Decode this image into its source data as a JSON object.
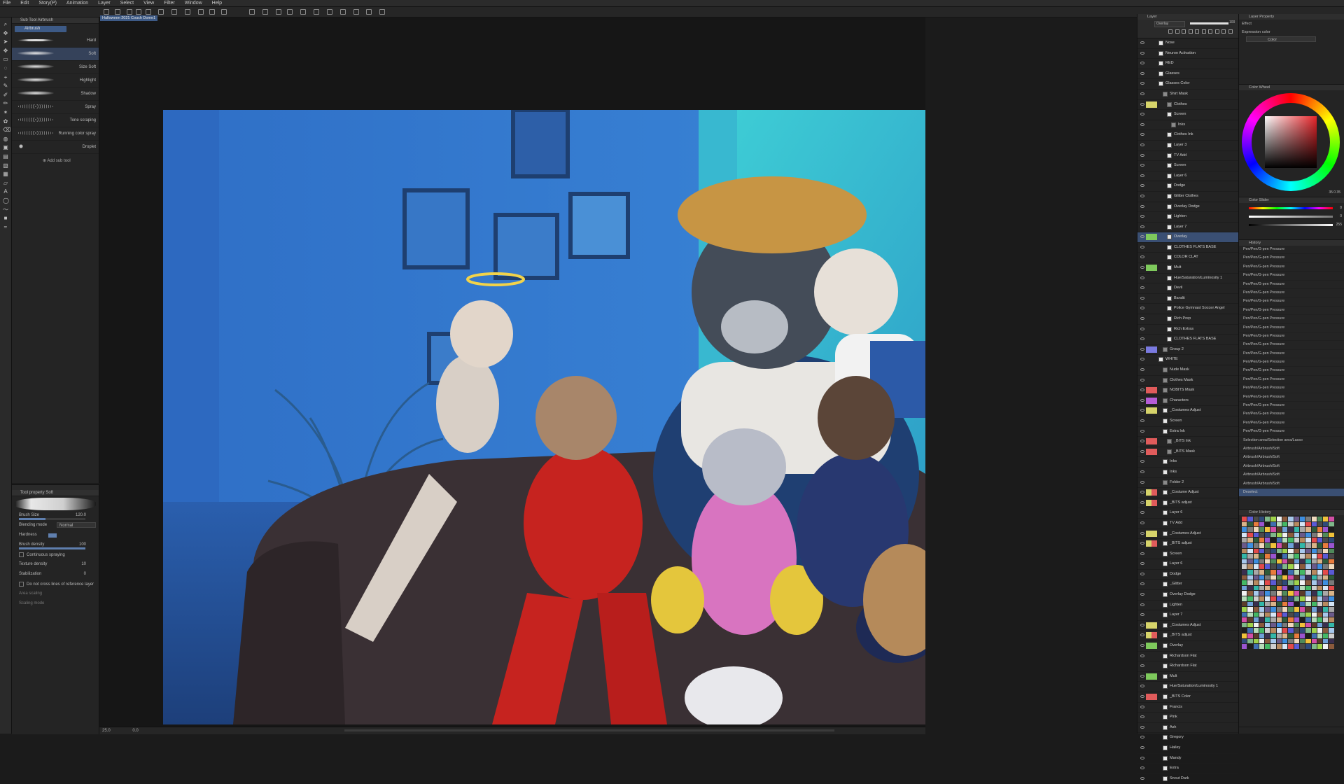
{
  "menu": [
    "File",
    "Edit",
    "Story(P)",
    "Animation",
    "Layer",
    "Select",
    "View",
    "Filter",
    "Window",
    "Help"
  ],
  "document_tab": "Halloween 2021 Couch Dome1",
  "subtool": {
    "panel_title": "Sub Tool Airbrush",
    "active_group": "Airbrush",
    "brushes": [
      {
        "name": "Hard",
        "selected": false,
        "style": "hard"
      },
      {
        "name": "Soft",
        "selected": true,
        "style": "soft"
      },
      {
        "name": "Size Soft",
        "selected": false,
        "style": "soft"
      },
      {
        "name": "Highlight",
        "selected": false,
        "style": "soft"
      },
      {
        "name": "Shadow",
        "selected": false,
        "style": "soft"
      },
      {
        "name": "Spray",
        "selected": false,
        "style": "spray"
      },
      {
        "name": "Tone scraping",
        "selected": false,
        "style": "spray"
      },
      {
        "name": "Running color spray",
        "selected": false,
        "style": "spray"
      },
      {
        "name": "Droplet",
        "selected": false,
        "style": "drop"
      }
    ],
    "add_sub_tool": "Add sub tool"
  },
  "tool_property": {
    "title": "Tool property Soft",
    "brush_size_label": "Brush Size",
    "brush_size_value": "120.0",
    "blending_mode_label": "Blending mode",
    "blending_mode_value": "Normal",
    "hardness_label": "Hardness",
    "brush_density_label": "Brush density",
    "brush_density_value": "100",
    "brush_density_fraction": 1.0,
    "continuous_spraying": "Continuous spraying",
    "texture_density_label": "Texture density",
    "texture_density_value": "10",
    "stabilization_label": "Stabilization",
    "stabilization_value": "0",
    "do_not_cross": "Do not cross lines of reference layer",
    "area_scaling": "Area scaling",
    "scaling_mode": "Scaling mode"
  },
  "status": {
    "zoom": "25.0",
    "angle": "0.0"
  },
  "layer_panel": {
    "title": "Layer",
    "blend_mode": "Overlay",
    "opacity": "100",
    "layers": [
      {
        "name": "Nose",
        "tag": "",
        "tag2": "",
        "indent": 0,
        "folder": false
      },
      {
        "name": "Neuron Activation",
        "tag": "",
        "tag2": "",
        "indent": 0,
        "folder": false
      },
      {
        "name": "RED",
        "tag": "",
        "tag2": "",
        "indent": 0,
        "folder": false
      },
      {
        "name": "Glasses",
        "tag": "",
        "tag2": "",
        "indent": 0,
        "folder": false
      },
      {
        "name": "Glasses Color",
        "tag": "",
        "tag2": "",
        "indent": 0,
        "folder": false
      },
      {
        "name": "Shirt Mask",
        "tag": "",
        "tag2": "",
        "indent": 1,
        "folder": true
      },
      {
        "name": "Clothes",
        "tag": "#d6d36a",
        "tag2": "#d6d36a",
        "indent": 2,
        "folder": true
      },
      {
        "name": "Screen",
        "tag": "",
        "tag2": "",
        "indent": 2,
        "folder": false
      },
      {
        "name": "Inks",
        "tag": "",
        "tag2": "",
        "indent": 3,
        "folder": true
      },
      {
        "name": "Clothes Ink",
        "tag": "",
        "tag2": "",
        "indent": 2,
        "folder": false
      },
      {
        "name": "Layer 3",
        "tag": "",
        "tag2": "",
        "indent": 2,
        "folder": false
      },
      {
        "name": "TV Add",
        "tag": "",
        "tag2": "",
        "indent": 2,
        "folder": false
      },
      {
        "name": "Screen",
        "tag": "",
        "tag2": "",
        "indent": 2,
        "folder": false
      },
      {
        "name": "Layer 6",
        "tag": "",
        "tag2": "",
        "indent": 2,
        "folder": false
      },
      {
        "name": "Dodge",
        "tag": "",
        "tag2": "",
        "indent": 2,
        "folder": false
      },
      {
        "name": "Glitter Clothes",
        "tag": "",
        "tag2": "",
        "indent": 2,
        "folder": false
      },
      {
        "name": "Overlay Dodge",
        "tag": "",
        "tag2": "",
        "indent": 2,
        "folder": false
      },
      {
        "name": "Lighten",
        "tag": "",
        "tag2": "",
        "indent": 2,
        "folder": false
      },
      {
        "name": "Layer 7",
        "tag": "",
        "tag2": "",
        "indent": 2,
        "folder": false
      },
      {
        "name": "Overlay",
        "tag": "#7ec95c",
        "tag2": "#7ec95c",
        "indent": 2,
        "folder": false,
        "selected": true
      },
      {
        "name": "CLOTHES FLATS BASE",
        "tag": "",
        "tag2": "",
        "indent": 2,
        "folder": false
      },
      {
        "name": "COLOR CLAT",
        "tag": "",
        "tag2": "",
        "indent": 2,
        "folder": false
      },
      {
        "name": "Mult",
        "tag": "#7ec95c",
        "tag2": "#7ec95c",
        "indent": 2,
        "folder": false
      },
      {
        "name": "Hue/Saturation/Luminosity 1",
        "tag": "",
        "tag2": "",
        "indent": 2,
        "folder": false
      },
      {
        "name": "Devil",
        "tag": "",
        "tag2": "",
        "indent": 2,
        "folder": false
      },
      {
        "name": "Bandit",
        "tag": "",
        "tag2": "",
        "indent": 2,
        "folder": false
      },
      {
        "name": "Police Gymnast Soccer Angel",
        "tag": "",
        "tag2": "",
        "indent": 2,
        "folder": false
      },
      {
        "name": "Rich Prep",
        "tag": "",
        "tag2": "",
        "indent": 2,
        "folder": false
      },
      {
        "name": "Rich Extras",
        "tag": "",
        "tag2": "",
        "indent": 2,
        "folder": false
      },
      {
        "name": "CLOTHES FLATS BASE",
        "tag": "",
        "tag2": "",
        "indent": 2,
        "folder": false
      },
      {
        "name": "Group 2",
        "tag": "#7a7ae0",
        "tag2": "#7a7ae0",
        "indent": 1,
        "folder": true
      },
      {
        "name": "WHITE",
        "tag": "",
        "tag2": "",
        "indent": 0,
        "folder": false
      },
      {
        "name": "Nude Mask",
        "tag": "",
        "tag2": "",
        "indent": 1,
        "folder": true
      },
      {
        "name": "Clothes Mask",
        "tag": "",
        "tag2": "",
        "indent": 1,
        "folder": true
      },
      {
        "name": "NOBITS Mask",
        "tag": "#e05b5b",
        "tag2": "#e05b5b",
        "indent": 1,
        "folder": true
      },
      {
        "name": "Characters",
        "tag": "#b55cd6",
        "tag2": "#b55cd6",
        "indent": 1,
        "folder": true
      },
      {
        "name": "_Costumes Adjust",
        "tag": "#d6d36a",
        "tag2": "#d6d36a",
        "indent": 1,
        "folder": false
      },
      {
        "name": "Screen",
        "tag": "",
        "tag2": "",
        "indent": 1,
        "folder": false
      },
      {
        "name": "Extra Ink",
        "tag": "",
        "tag2": "",
        "indent": 1,
        "folder": false
      },
      {
        "name": "_BITS Ink",
        "tag": "#e05b5b",
        "tag2": "#e05b5b",
        "indent": 2,
        "folder": true
      },
      {
        "name": "_BITS Mask",
        "tag": "#e05b5b",
        "tag2": "#e05b5b",
        "indent": 2,
        "folder": true
      },
      {
        "name": "Inks",
        "tag": "",
        "tag2": "",
        "indent": 1,
        "folder": false
      },
      {
        "name": "Inks",
        "tag": "",
        "tag2": "",
        "indent": 1,
        "folder": false
      },
      {
        "name": "Folder 2",
        "tag": "",
        "tag2": "",
        "indent": 1,
        "folder": true
      },
      {
        "name": "_Costume Adjust",
        "tag": "#d6d36a",
        "tag2": "#e05b5b",
        "indent": 1,
        "folder": false
      },
      {
        "name": "_BITS adjust",
        "tag": "#d6d36a",
        "tag2": "#e05b5b",
        "indent": 1,
        "folder": false
      },
      {
        "name": "Layer 6",
        "tag": "",
        "tag2": "",
        "indent": 1,
        "folder": false
      },
      {
        "name": "TV Add",
        "tag": "",
        "tag2": "",
        "indent": 1,
        "folder": false
      },
      {
        "name": "_Costumes Adjust",
        "tag": "#d6d36a",
        "tag2": "#d6d36a",
        "indent": 1,
        "folder": false
      },
      {
        "name": "_BITS adjust",
        "tag": "#d6d36a",
        "tag2": "#e05b5b",
        "indent": 1,
        "folder": false
      },
      {
        "name": "Screen",
        "tag": "",
        "tag2": "",
        "indent": 1,
        "folder": false
      },
      {
        "name": "Layer 6",
        "tag": "",
        "tag2": "",
        "indent": 1,
        "folder": false
      },
      {
        "name": "Dodge",
        "tag": "",
        "tag2": "",
        "indent": 1,
        "folder": false
      },
      {
        "name": "_Glitter",
        "tag": "",
        "tag2": "",
        "indent": 1,
        "folder": false
      },
      {
        "name": "Overlay Dodge",
        "tag": "",
        "tag2": "",
        "indent": 1,
        "folder": false
      },
      {
        "name": "Lighten",
        "tag": "",
        "tag2": "",
        "indent": 1,
        "folder": false
      },
      {
        "name": "Layer 7",
        "tag": "",
        "tag2": "",
        "indent": 1,
        "folder": false
      },
      {
        "name": "_Costumes Adjust",
        "tag": "#d6d36a",
        "tag2": "#d6d36a",
        "indent": 1,
        "folder": false
      },
      {
        "name": "_BITS adjust",
        "tag": "#d6d36a",
        "tag2": "#e05b5b",
        "indent": 1,
        "folder": false
      },
      {
        "name": "Overlay",
        "tag": "#7ec95c",
        "tag2": "#7ec95c",
        "indent": 1,
        "folder": false
      },
      {
        "name": "Richardson Flat",
        "tag": "",
        "tag2": "",
        "indent": 1,
        "folder": false
      },
      {
        "name": "Richardson Flat",
        "tag": "",
        "tag2": "",
        "indent": 1,
        "folder": false
      },
      {
        "name": "Mult",
        "tag": "#7ec95c",
        "tag2": "#7ec95c",
        "indent": 1,
        "folder": false
      },
      {
        "name": "Hue/Saturation/Luminosity 1",
        "tag": "",
        "tag2": "",
        "indent": 1,
        "folder": false
      },
      {
        "name": "_BITS Color",
        "tag": "#e05b5b",
        "tag2": "#e05b5b",
        "indent": 1,
        "folder": false
      },
      {
        "name": "Francis",
        "tag": "",
        "tag2": "",
        "indent": 1,
        "folder": false
      },
      {
        "name": "Pink",
        "tag": "",
        "tag2": "",
        "indent": 1,
        "folder": false
      },
      {
        "name": "Ash",
        "tag": "",
        "tag2": "",
        "indent": 1,
        "folder": false
      },
      {
        "name": "Gregory",
        "tag": "",
        "tag2": "",
        "indent": 1,
        "folder": false
      },
      {
        "name": "Hailey",
        "tag": "",
        "tag2": "",
        "indent": 1,
        "folder": false
      },
      {
        "name": "Mandy",
        "tag": "",
        "tag2": "",
        "indent": 1,
        "folder": false
      },
      {
        "name": "Extra",
        "tag": "",
        "tag2": "",
        "indent": 1,
        "folder": false
      },
      {
        "name": "Snout Dark",
        "tag": "",
        "tag2": "",
        "indent": 1,
        "folder": false
      }
    ]
  },
  "layer_property": {
    "title": "Layer Property",
    "effect_label": "Effect",
    "expression_color_label": "Expression color",
    "expression_color_value": "Color"
  },
  "color_wheel": {
    "title": "Color Wheel",
    "values": "35 0 35"
  },
  "color_slider": {
    "title": "Color Slider",
    "r": "8",
    "g": "0",
    "b": "255"
  },
  "history": {
    "title": "History",
    "items": [
      "Pen/Pen/G-pen Pressure",
      "Pen/Pen/G-pen Pressure",
      "Pen/Pen/G-pen Pressure",
      "Pen/Pen/G-pen Pressure",
      "Pen/Pen/G-pen Pressure",
      "Pen/Pen/G-pen Pressure",
      "Pen/Pen/G-pen Pressure",
      "Pen/Pen/G-pen Pressure",
      "Pen/Pen/G-pen Pressure",
      "Pen/Pen/G-pen Pressure",
      "Pen/Pen/G-pen Pressure",
      "Pen/Pen/G-pen Pressure",
      "Pen/Pen/G-pen Pressure",
      "Pen/Pen/G-pen Pressure",
      "Pen/Pen/G-pen Pressure",
      "Pen/Pen/G-pen Pressure",
      "Pen/Pen/G-pen Pressure",
      "Pen/Pen/G-pen Pressure",
      "Pen/Pen/G-pen Pressure",
      "Pen/Pen/G-pen Pressure",
      "Pen/Pen/G-pen Pressure",
      "Pen/Pen/G-pen Pressure",
      "Selection area/Selection area/Lasso",
      "Airbrush/Airbrush/Soft",
      "Airbrush/Airbrush/Soft",
      "Airbrush/Airbrush/Soft",
      "Airbrush/Airbrush/Soft",
      "Airbrush/Airbrush/Soft",
      "Deselect"
    ],
    "selected_index": 28
  },
  "color_history": {
    "title": "Color History"
  },
  "colors": {
    "accent": "#3d5a86",
    "panel": "#242424",
    "selected": "#3a4f73"
  }
}
